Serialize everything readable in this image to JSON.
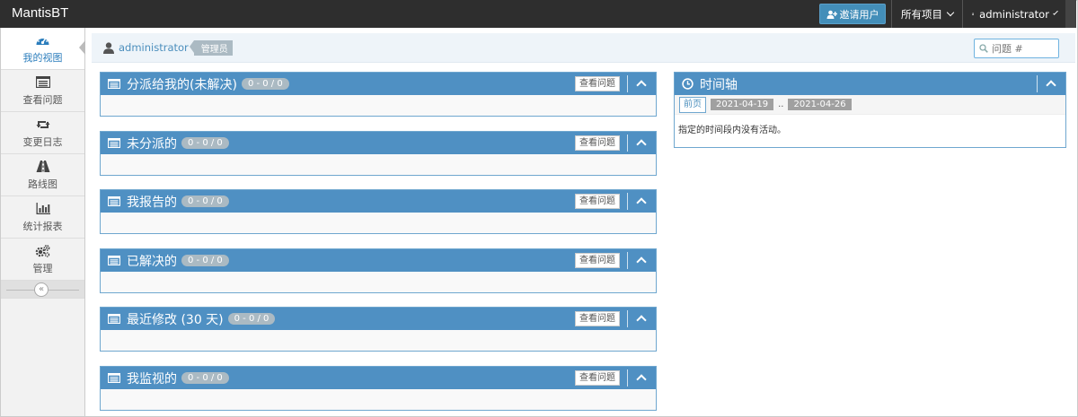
{
  "navbar": {
    "brand": "MantisBT",
    "invite_label": "邀请用户",
    "projects_label": "所有项目",
    "user_label": "administrator"
  },
  "sidebar": {
    "items": [
      {
        "label": "我的视图",
        "icon": "dashboard-icon",
        "active": true
      },
      {
        "label": "查看问题",
        "icon": "list-icon"
      },
      {
        "label": "变更日志",
        "icon": "retweet-icon"
      },
      {
        "label": "路线图",
        "icon": "road-icon"
      },
      {
        "label": "统计报表",
        "icon": "bar-chart-icon"
      },
      {
        "label": "管理",
        "icon": "gears-icon"
      }
    ],
    "collapse_symbol": "«"
  },
  "breadcrumb": {
    "user": "administrator",
    "role": "管理员"
  },
  "search": {
    "placeholder": "问题 #"
  },
  "widgets": [
    {
      "title": "分派给我的(未解决)",
      "badge": "0 - 0 / 0",
      "button": "查看问题"
    },
    {
      "title": "未分派的",
      "badge": "0 - 0 / 0",
      "button": "查看问题"
    },
    {
      "title": "我报告的",
      "badge": "0 - 0 / 0",
      "button": "查看问题"
    },
    {
      "title": "已解决的",
      "badge": "0 - 0 / 0",
      "button": "查看问题"
    },
    {
      "title": "最近修改 (30 天)",
      "badge": "0 - 0 / 0",
      "button": "查看问题"
    },
    {
      "title": "我监视的",
      "badge": "0 - 0 / 0",
      "button": "查看问题"
    }
  ],
  "timeline": {
    "title": "时间轴",
    "prev_label": "前页",
    "date_from": "2021-04-19",
    "separator": "..",
    "date_to": "2021-04-26",
    "empty_message": "指定的时间段内没有活动。"
  },
  "colors": {
    "navbar": "#2e2e2e",
    "widget_header": "#4f90c3",
    "accent": "#438eb9",
    "badge": "#abbac3"
  }
}
